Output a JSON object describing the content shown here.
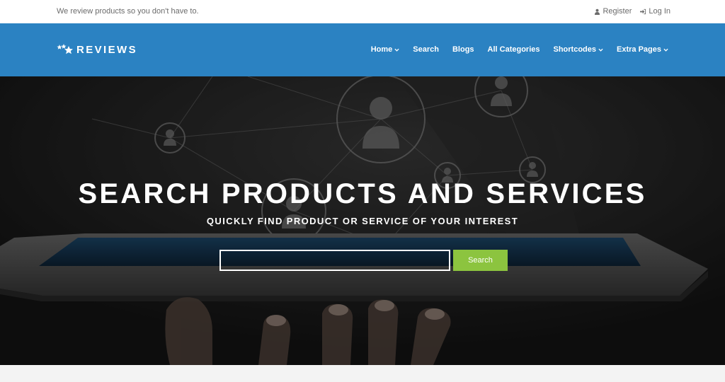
{
  "topbar": {
    "tagline": "We review products so you don't have to.",
    "register_label": "Register",
    "register_icon": "user-icon",
    "login_label": "Log In",
    "login_icon": "sign-in-icon"
  },
  "navbar": {
    "brand": "REVIEWS",
    "brand_icon": "stars-icon",
    "brand_color": "#2b82c2",
    "menu": [
      {
        "label": "Home",
        "has_dropdown": true
      },
      {
        "label": "Search",
        "has_dropdown": false
      },
      {
        "label": "Blogs",
        "has_dropdown": false
      },
      {
        "label": "All Categories",
        "has_dropdown": false
      },
      {
        "label": "Shortcodes",
        "has_dropdown": true
      },
      {
        "label": "Extra Pages",
        "has_dropdown": true
      }
    ]
  },
  "hero": {
    "title": "SEARCH PRODUCTS AND SERVICES",
    "subtitle": "QUICKLY FIND PRODUCT OR SERVICE OF YOUR INTEREST",
    "search_value": "",
    "search_button_label": "Search",
    "search_button_color": "#8cc43f",
    "background_image": "hand-holding-tablet-with-network-user-icons"
  }
}
